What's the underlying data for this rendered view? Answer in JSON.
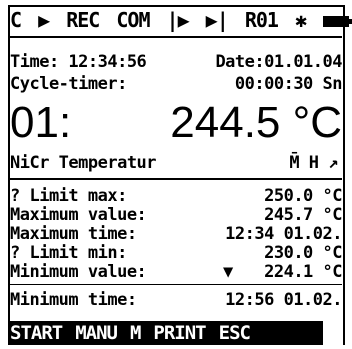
{
  "status_bar": {
    "channel": "C",
    "play_icon": "▶",
    "rec": "REC",
    "com": "COM",
    "step_icon": "|▶",
    "step_icon2": "▶|",
    "room": "R01",
    "star": "✱",
    "battery_icon": "battery-icon"
  },
  "time_row": {
    "time": "Time: 12:34:56",
    "date": "Date:01.01.04"
  },
  "cycle_row": {
    "label": "Cycle-timer:",
    "value": "00:00:30 Sn"
  },
  "main_reading": {
    "channel": "01:",
    "value": "244.5 °C"
  },
  "sensor_row": {
    "label": "NiCr Temperatur",
    "flags": "M̄  H  ↗"
  },
  "limits": [
    {
      "label": "? Limit max:",
      "marker": "",
      "value": "250.0 °C"
    },
    {
      "label": "Maximum value:",
      "marker": "",
      "value": "245.7 °C"
    },
    {
      "label": "Maximum time:",
      "marker": "",
      "value": "12:34  01.02."
    },
    {
      "label": "? Limit min:",
      "marker": "",
      "value": "230.0 °C"
    },
    {
      "label": "Minimum value:",
      "marker": "▼",
      "value": "224.1 °C"
    },
    {
      "label": "Minimum time:",
      "marker": "",
      "value": "12:56  01.02."
    }
  ],
  "softkeys": [
    "START",
    "MANU",
    "M",
    "PRINT",
    "ESC"
  ]
}
